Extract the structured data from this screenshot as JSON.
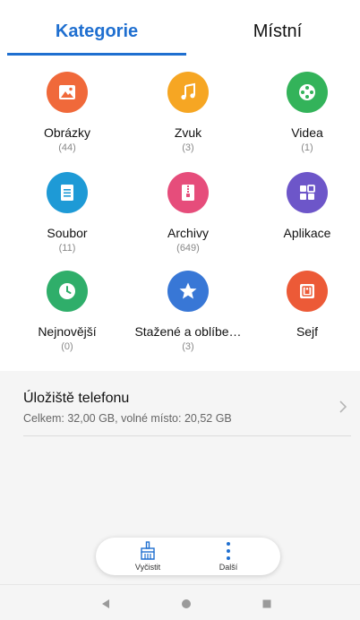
{
  "tabs": {
    "categories": "Kategorie",
    "local": "Místní"
  },
  "categories": [
    {
      "label": "Obrázky",
      "count": "(44)",
      "icon": "image-icon",
      "color": "#f0693a"
    },
    {
      "label": "Zvuk",
      "count": "(3)",
      "icon": "music-note-icon",
      "color": "#f6a623"
    },
    {
      "label": "Videa",
      "count": "(1)",
      "icon": "film-reel-icon",
      "color": "#33b35a"
    },
    {
      "label": "Soubor",
      "count": "(11)",
      "icon": "document-icon",
      "color": "#1e9ad6"
    },
    {
      "label": "Archivy",
      "count": "(649)",
      "icon": "archive-zip-icon",
      "color": "#e64d7b"
    },
    {
      "label": "Aplikace",
      "count": "",
      "icon": "apps-grid-icon",
      "color": "#6d56c9"
    },
    {
      "label": "Nejnovější",
      "count": "(0)",
      "icon": "clock-icon",
      "color": "#2fae6a"
    },
    {
      "label": "Stažené a oblíbe…",
      "count": "(3)",
      "icon": "star-icon",
      "color": "#3877d6"
    },
    {
      "label": "Sejf",
      "count": "",
      "icon": "safe-lock-icon",
      "color": "#ec5a37"
    }
  ],
  "storage": {
    "title": "Úložiště telefonu",
    "details": "Celkem: 32,00 GB, volné místo: 20,52 GB"
  },
  "actions": {
    "clean": "Vyčistit",
    "more": "Další"
  },
  "colors": {
    "accent": "#1f6fd0"
  }
}
